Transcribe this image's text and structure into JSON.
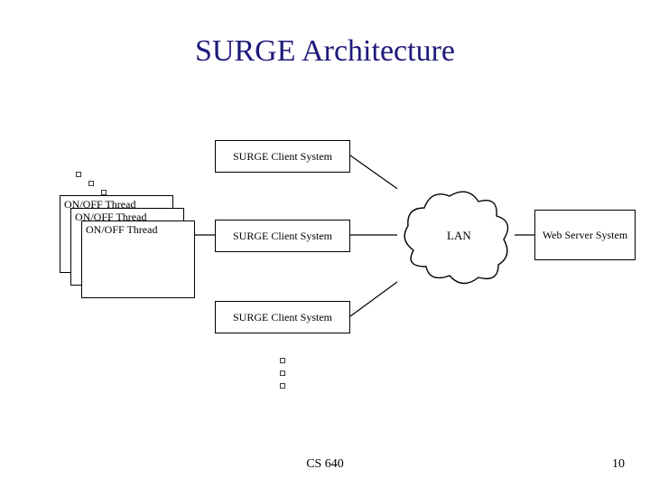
{
  "title": "SURGE Architecture",
  "threads": {
    "t1": "ON/OFF Thread",
    "t2": "ON/OFF Thread",
    "t3": "ON/OFF Thread"
  },
  "clients": {
    "c1": "SURGE Client System",
    "c2": "SURGE Client System",
    "c3": "SURGE Client System"
  },
  "lan": "LAN",
  "server": "Web Server System",
  "footer": {
    "course": "CS 640",
    "page": "10"
  }
}
